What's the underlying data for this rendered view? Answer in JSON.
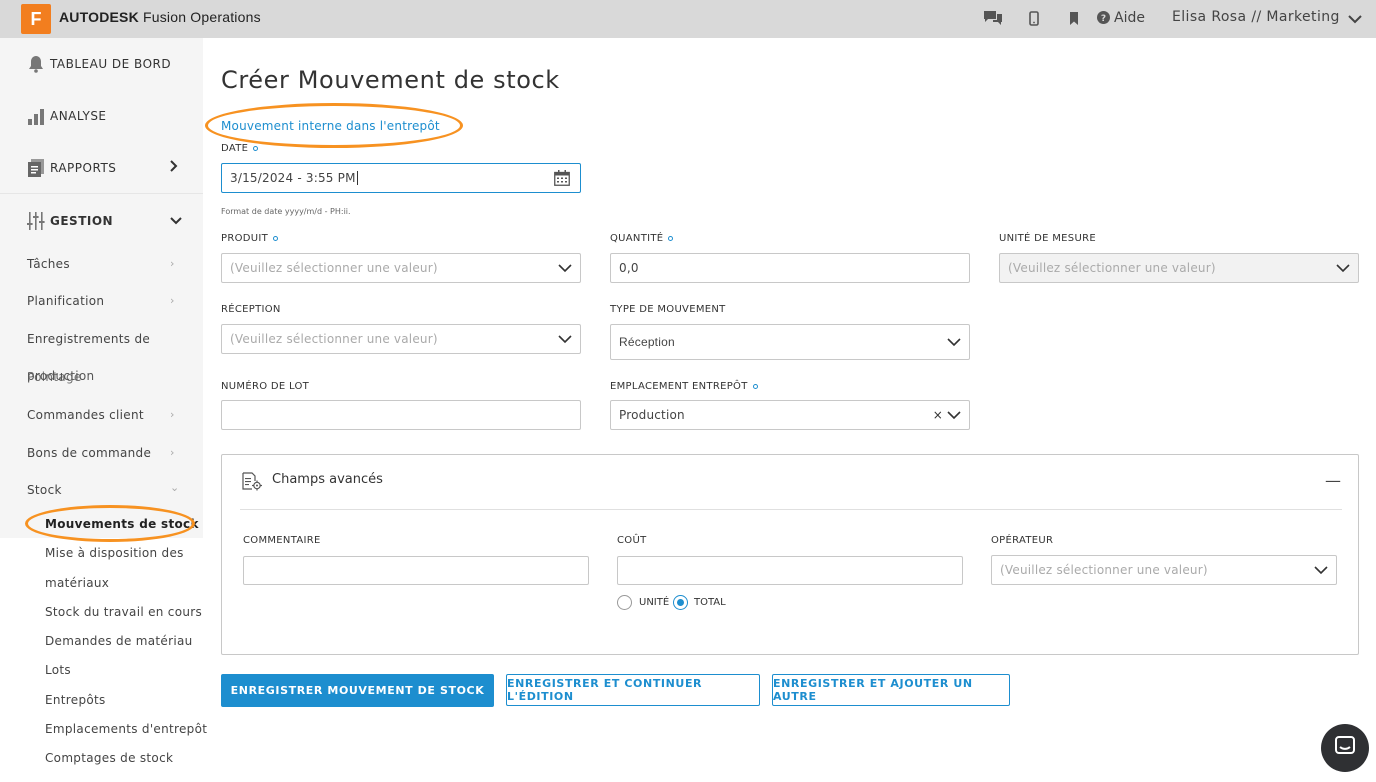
{
  "topbar": {
    "logo_letter": "F",
    "brand_bold": "AUTODESK",
    "brand_rest": " Fusion Operations",
    "help_label": "Aide",
    "user_label": "Elisa Rosa // Marketing",
    "icons": [
      "chat-icon",
      "mobile-icon",
      "bookmark-icon",
      "help-icon",
      "chevron-down-icon"
    ]
  },
  "sidebar": {
    "main": [
      {
        "label": "TABLEAU DE BORD",
        "icon": "bell-icon"
      },
      {
        "label": "ANALYSE",
        "icon": "bar-chart-icon"
      },
      {
        "label": "RAPPORTS",
        "icon": "document-icon"
      },
      {
        "label": "GESTION",
        "icon": "sliders-icon"
      }
    ],
    "gestion_items": [
      "Tâches",
      "Planification",
      "Enregistrements de",
      "production",
      "Pointage",
      "Commandes client",
      "Bons de commande",
      "Stock"
    ],
    "stock_items": [
      "Mouvements de stock",
      "Mise à disposition des",
      "matériaux",
      "Stock du travail en cours",
      "Demandes de matériau",
      "Lots",
      "Entrepôts",
      "Emplacements d'entrepôt",
      "Comptages de stock"
    ]
  },
  "form": {
    "title": "Créer Mouvement de stock",
    "sublink": "Mouvement interne dans l'entrepôt",
    "date_label": "DATE",
    "date_value": "3/15/2024 - 3:55 PM",
    "date_hint": "Format de date yyyy/m/d - PH:ii.",
    "produit_label": "PRODUIT",
    "produit_placeholder": "(Veuillez sélectionner une valeur)",
    "quantite_label": "QUANTITÉ",
    "quantite_value": "0,0",
    "unite_label": "UNITÉ DE MESURE",
    "unite_placeholder": "(Veuillez sélectionner une valeur)",
    "reception_label": "RÉCEPTION",
    "reception_placeholder": "(Veuillez sélectionner une valeur)",
    "type_label": "TYPE DE MOUVEMENT",
    "type_value": "Réception",
    "lot_label": "NUMÉRO DE LOT",
    "lot_value": "",
    "emplacement_label": "EMPLACEMENT ENTREPÔT",
    "emplacement_value": "Production",
    "emplacement_clear": "×"
  },
  "advanced": {
    "title": "Champs avancés",
    "collapse_symbol": "—",
    "commentaire_label": "COMMENTAIRE",
    "cout_label": "COÛT",
    "operateur_label": "OPÉRATEUR",
    "operateur_placeholder": "(Veuillez sélectionner une valeur)",
    "radio_unite": "UNITÉ",
    "radio_total": "TOTAL",
    "selected_radio": "TOTAL"
  },
  "buttons": {
    "save": "ENREGISTRER MOUVEMENT DE STOCK",
    "save_continue": "ENREGISTRER ET CONTINUER L'ÉDITION",
    "save_add": "ENREGISTRER ET AJOUTER UN AUTRE"
  },
  "colors": {
    "accent": "#1d8ecf",
    "highlight": "#f79221",
    "logo": "#f27e1f"
  }
}
